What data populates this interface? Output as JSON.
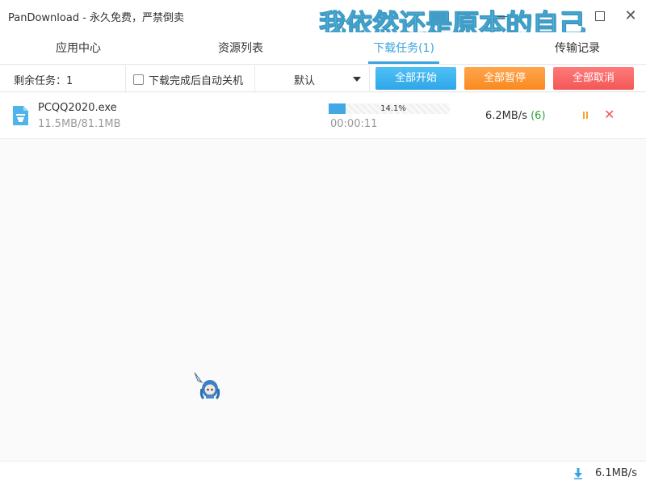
{
  "window": {
    "title": "PanDownload - 永久免费，严禁倒卖",
    "watermark": "我依然还是原本的自己"
  },
  "tabs": [
    {
      "label": "应用中心",
      "active": false
    },
    {
      "label": "资源列表",
      "active": false
    },
    {
      "label": "下载任务(1)",
      "active": true
    },
    {
      "label": "传输记录",
      "active": false
    }
  ],
  "toolbar": {
    "remaining": "剩余任务：1",
    "auto_shutdown_label": "下载完成后自动关机",
    "auto_shutdown_checked": false,
    "sort_value": "默认",
    "start_all": "全部开始",
    "pause_all": "全部暂停",
    "cancel_all": "全部取消"
  },
  "task": {
    "file_name": "PCQQ2020.exe",
    "size": "11.5MB/81.1MB",
    "progress_percent": 14.1,
    "progress_text": "14.1%",
    "elapsed": "00:00:11",
    "speed": "6.2MB/s",
    "connections": "(6)"
  },
  "status": {
    "total_speed": "6.1MB/s"
  },
  "colors": {
    "accent": "#3aa3df",
    "start": "#2fa6e8",
    "pause": "#f98a1f",
    "cancel": "#f45757",
    "watermark": "#9ad3ea"
  }
}
